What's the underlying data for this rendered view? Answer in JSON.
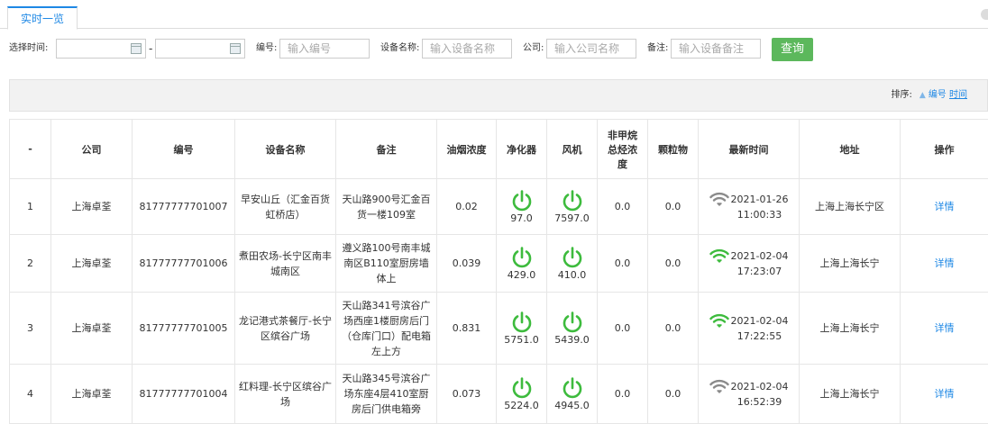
{
  "tab": {
    "label": "实时一览"
  },
  "filters": {
    "time_label": "选择时间:",
    "dash": "-",
    "number_label": "编号:",
    "number_placeholder": "输入编号",
    "device_label": "设备名称:",
    "device_placeholder": "输入设备名称",
    "company_label": "公司:",
    "company_placeholder": "输入公司名称",
    "remark_label": "备注:",
    "remark_placeholder": "输入设备备注",
    "query_button": "查询"
  },
  "sort": {
    "label": "排序:",
    "by_number": "编号",
    "by_time": "时间"
  },
  "table": {
    "headers": [
      "-",
      "公司",
      "编号",
      "设备名称",
      "备注",
      "油烟浓度",
      "净化器",
      "风机",
      "非甲烷总烃浓度",
      "颗粒物",
      "最新时间",
      "地址",
      "操作"
    ],
    "rows": [
      {
        "index": "1",
        "company": "上海卓荃",
        "number": "81777777701007",
        "device": "早安山丘（汇金百货虹桥店）",
        "remark": "天山路900号汇金百货一楼109室",
        "smoke": "0.02",
        "purifier": "97.0",
        "fan": "7597.0",
        "nmhc": "0.0",
        "particles": "0.0",
        "signal": "weak",
        "date": "2021-01-26",
        "time": "11:00:33",
        "address": "上海上海长宁区",
        "action": "详情"
      },
      {
        "index": "2",
        "company": "上海卓荃",
        "number": "81777777701006",
        "device": "煮田农场-长宁区南丰城南区",
        "remark": "遵义路100号南丰城南区B110室厨房墙体上",
        "smoke": "0.039",
        "purifier": "429.0",
        "fan": "410.0",
        "nmhc": "0.0",
        "particles": "0.0",
        "signal": "strong",
        "date": "2021-02-04",
        "time": "17:23:07",
        "address": "上海上海长宁",
        "action": "详情"
      },
      {
        "index": "3",
        "company": "上海卓荃",
        "number": "81777777701005",
        "device": "龙记港式茶餐厅-长宁区缤谷广场",
        "remark": "天山路341号滨谷广场西座1楼厨房后门（仓库门口）配电箱左上方",
        "smoke": "0.831",
        "purifier": "5751.0",
        "fan": "5439.0",
        "nmhc": "0.0",
        "particles": "0.0",
        "signal": "strong",
        "date": "2021-02-04",
        "time": "17:22:55",
        "address": "上海上海长宁",
        "action": "详情"
      },
      {
        "index": "4",
        "company": "上海卓荃",
        "number": "81777777701004",
        "device": "红料理-长宁区缤谷广场",
        "remark": "天山路345号滨谷广场东座4层410室厨房后门供电箱旁",
        "smoke": "0.073",
        "purifier": "5224.0",
        "fan": "4945.0",
        "nmhc": "0.0",
        "particles": "0.0",
        "signal": "weak",
        "date": "2021-02-04",
        "time": "16:52:39",
        "address": "上海上海长宁",
        "action": "详情"
      }
    ]
  },
  "colors": {
    "accent": "#1e88e5",
    "power_on": "#3dbb3d",
    "signal_strong": "#3dbb3d",
    "signal_weak": "#8a8a8a",
    "query_button": "#5cb85c"
  },
  "icons": {
    "power": "power-icon",
    "signal": "wifi-signal-icon",
    "calendar": "calendar-icon",
    "sort": "up-arrow-icon"
  }
}
